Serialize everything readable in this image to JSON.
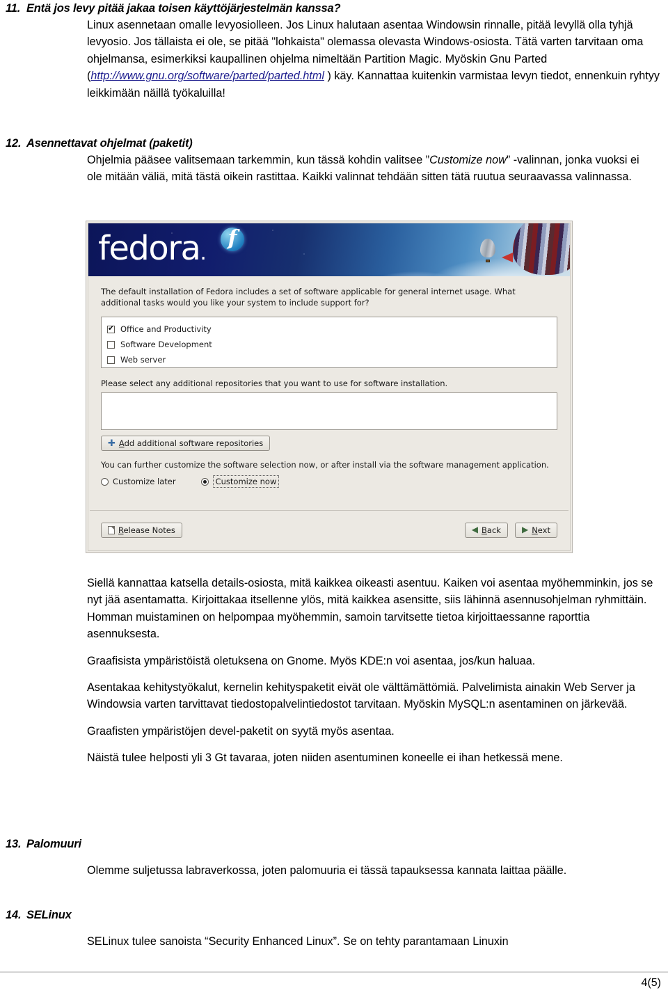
{
  "document": {
    "sections": [
      {
        "number": "11.",
        "title": "Entä jos levy pitää jakaa toisen käyttöjärjestelmän kanssa?",
        "paragraph_pre": "Linux asennetaan omalle levyosiolleen. Jos Linux halutaan asentaa Windowsin rinnalle, pitää levyllä olla tyhjä levyosio. Jos tällaista ei ole, se pitää \"lohkaista\" olemassa olevasta Windows-osiosta. Tätä varten tarvitaan oma ohjelmansa, esimerkiksi  kaupallinen ohjelma nimeltään Partition Magic. Myöskin Gnu Parted (",
        "link": "http://www.gnu.org/software/parted/parted.html",
        "paragraph_post": " ) käy. Kannattaa kuitenkin varmistaa levyn tiedot, ennenkuin ryhtyy leikkimään näillä työkaluilla!"
      },
      {
        "number": "12.",
        "title": "Asennettavat ohjelmat (paketit)",
        "paragraph_pre": "Ohjelmia pääsee valitsemaan tarkemmin, kun tässä kohdin valitsee ”",
        "emphasis": "Customize now",
        "paragraph_post": "” -valinnan, jonka vuoksi ei ole mitään väliä, mitä tästä oikein rastittaa. Kaikki valinnat tehdään sitten tätä ruutua seuraavassa valinnassa."
      },
      {
        "number": "13.",
        "title": "Palomuuri",
        "paragraph": "Olemme suljetussa labraverkossa, joten palomuuria ei tässä tapauksessa kannata laittaa päälle."
      },
      {
        "number": "14.",
        "title": "SELinux",
        "paragraph": "SELinux tulee sanoista “Security Enhanced Linux”. Se on tehty parantamaan Linuxin"
      }
    ],
    "lower_paragraphs": [
      "Siellä kannattaa katsella details-osiosta, mitä kaikkea oikeasti asentuu. Kaiken voi asentaa myöhemminkin, jos se nyt jää asentamatta. Kirjoittakaa itsellenne ylös, mitä kaikkea asensitte, siis lähinnä asennusohjelman ryhmittäin. Homman muistaminen on helpompaa myöhemmin, samoin  tarvitsette tietoa kirjoittaessanne raporttia asennuksesta.",
      "Graafisista ympäristöistä oletuksena on Gnome. Myös KDE:n voi asentaa, jos/kun haluaa.",
      "Asentakaa kehitystyökalut, kernelin kehityspaketit eivät ole välttämättömiä. Palvelimista ainakin Web Server ja Windowsia varten tarvittavat tiedostopalvelintiedostot tarvitaan. Myöskin MySQL:n asentaminen on järkevää.",
      "Graafisten ympäristöjen devel-paketit on syytä myös asentaa.",
      "Näistä tulee helposti yli 3 Gt tavaraa, joten niiden asentuminen koneelle ei ihan hetkessä mene."
    ],
    "page_number": "4(5)"
  },
  "installer": {
    "brand": "fedora",
    "brand_dot": ".",
    "logo_letter": "f",
    "intro": "The default installation of Fedora includes a set of software applicable for general internet usage. What additional tasks would you like your system to include support for?",
    "tasks": [
      {
        "label": "Office and Productivity",
        "checked": true
      },
      {
        "label": "Software Development",
        "checked": false
      },
      {
        "label": "Web server",
        "checked": false
      }
    ],
    "repo_label": "Please select any additional repositories that you want to use for software installation.",
    "repo_list_value": "",
    "add_repo_button": {
      "accel": "A",
      "rest": "dd additional software repositories"
    },
    "further_text": "You can further customize the software selection now, or after install via the software management application.",
    "radios": [
      {
        "label_pre": "Customize ",
        "accel": "l",
        "label_post": "ater",
        "selected": false
      },
      {
        "label_pre": "",
        "accel": "C",
        "label_post": "ustomize now",
        "selected": true
      }
    ],
    "buttons": {
      "release_notes": {
        "accel": "R",
        "rest": "elease Notes"
      },
      "back": {
        "accel": "B",
        "rest": "ack"
      },
      "next": {
        "accel": "N",
        "rest": "ext"
      }
    },
    "colors": {
      "banner_dark": "#0c1559",
      "banner_light": "#cfe0ea",
      "chrome": "#ece9e3",
      "accent": "#3b6ea5"
    }
  }
}
